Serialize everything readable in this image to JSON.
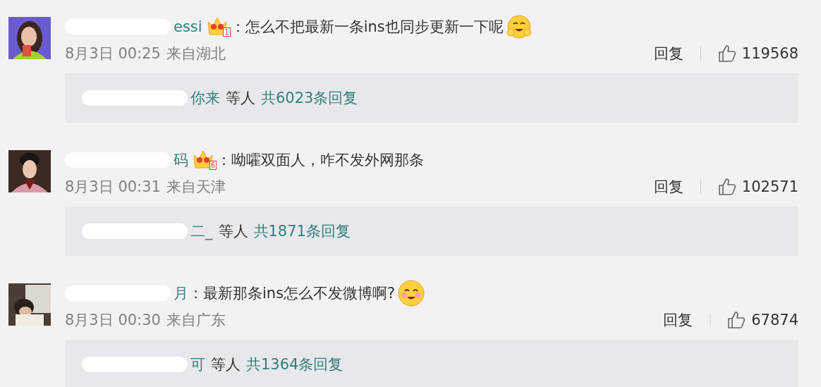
{
  "comments": [
    {
      "author": "essi",
      "badge": "1",
      "text": "：怎么不把最新一条ins也同步更新一下呢",
      "emoji": {
        "kind": "hug"
      },
      "time": "8月3日 00:25",
      "source": "来自湖北",
      "reply_label": "回复",
      "likes": "119568",
      "thread": {
        "names": "你来",
        "by": "等人",
        "total": "共6023条回复"
      }
    },
    {
      "author": "码",
      "badge": "6",
      "text": "：呦嚯双面人，咋不发外网那条",
      "time": "8月3日 00:31",
      "source": "来自天津",
      "reply_label": "回复",
      "likes": "102571",
      "thread": {
        "names": "二_",
        "by": "等人",
        "total": "共1871条回复"
      }
    },
    {
      "author": "月",
      "text": "：最新那条ins怎么不发微博啊?",
      "emoji": {
        "kind": "smile"
      },
      "time": "8月3日 00:30",
      "source": "来自广东",
      "reply_label": "回复",
      "likes": "67874",
      "thread": {
        "names": "可",
        "by": "等人",
        "total": "共1364条回复"
      }
    }
  ]
}
